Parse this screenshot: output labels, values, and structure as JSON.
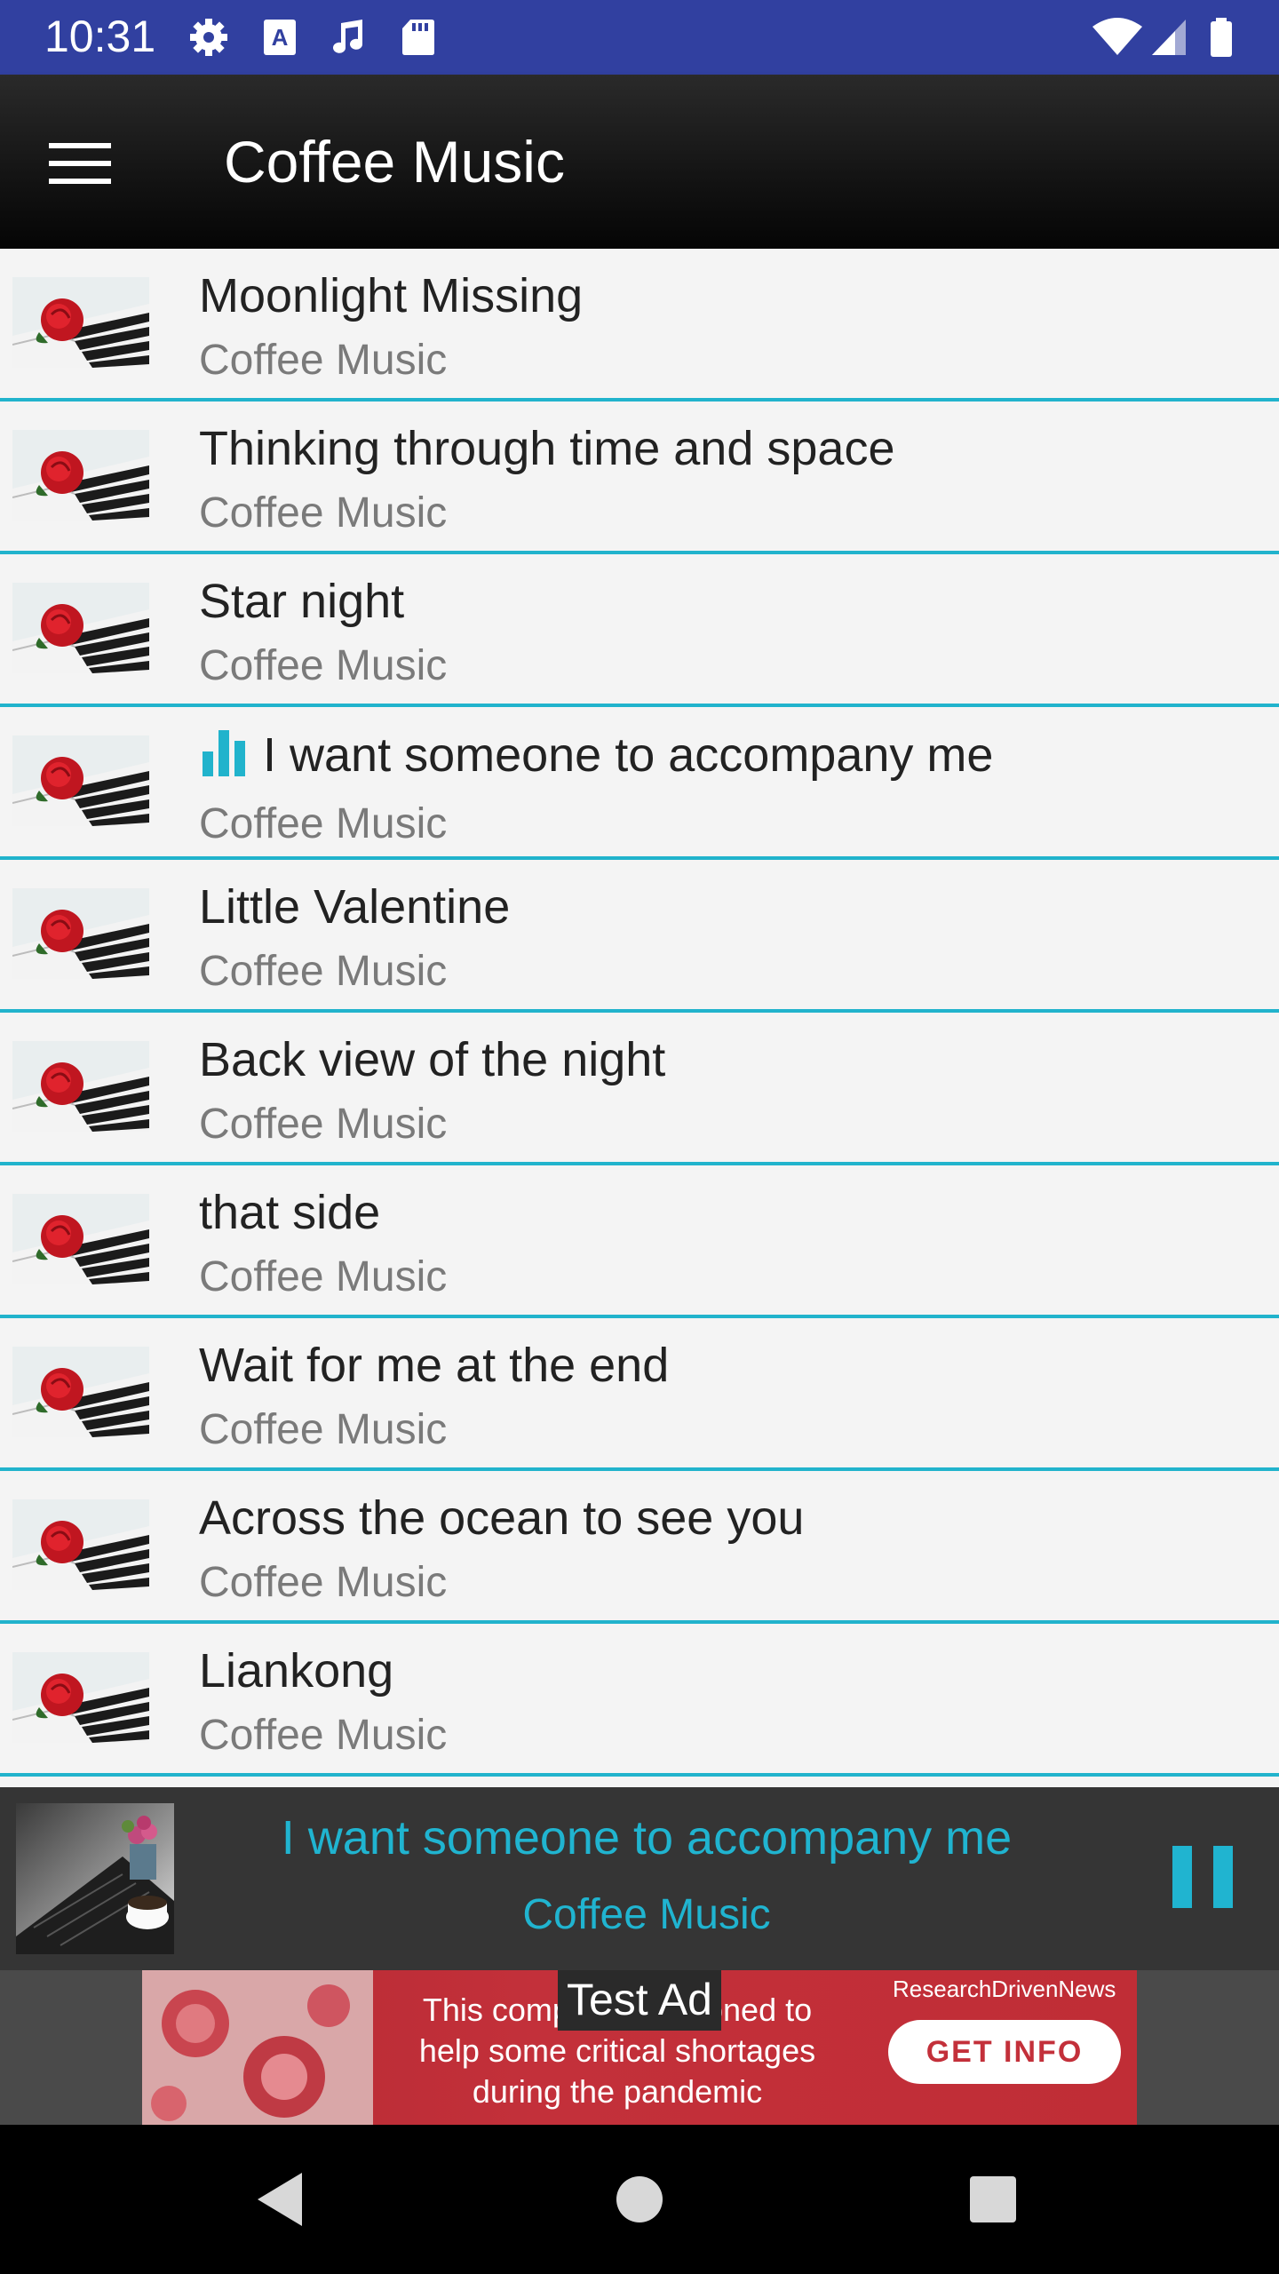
{
  "status_bar": {
    "time": "10:31",
    "left_icons": [
      "gear-icon",
      "text-a-icon",
      "music-note-icon",
      "sd-card-icon"
    ],
    "right_icons": [
      "wifi-icon",
      "cell-signal-icon",
      "battery-icon"
    ],
    "background": "#3140a0"
  },
  "toolbar": {
    "title": "Coffee Music",
    "menu_icon": "hamburger-menu-icon"
  },
  "songs": [
    {
      "title": "Moonlight Missing",
      "artist": "Coffee Music",
      "playing": false
    },
    {
      "title": "Thinking through time and space",
      "artist": "Coffee Music",
      "playing": false
    },
    {
      "title": "Star night",
      "artist": "Coffee Music",
      "playing": false
    },
    {
      "title": "I want someone to accompany me",
      "artist": "Coffee Music",
      "playing": true
    },
    {
      "title": "Little Valentine",
      "artist": "Coffee Music",
      "playing": false
    },
    {
      "title": "Back view of the night",
      "artist": "Coffee Music",
      "playing": false
    },
    {
      "title": "that side",
      "artist": "Coffee Music",
      "playing": false
    },
    {
      "title": "Wait for me at the end",
      "artist": "Coffee Music",
      "playing": false
    },
    {
      "title": "Across the ocean to see you",
      "artist": "Coffee Music",
      "playing": false
    },
    {
      "title": "Liankong",
      "artist": "Coffee Music",
      "playing": false
    }
  ],
  "now_playing": {
    "title": "I want someone to accompany me",
    "artist": "Coffee Music",
    "control_icon": "pause-icon",
    "accent_color": "#20b4d0"
  },
  "ad": {
    "label": "Test Ad",
    "text_line1": "This company positioned to",
    "text_line2": "help some critical shortages",
    "text_line3": "during the pandemic",
    "brand": "ResearchDrivenNews",
    "cta": "GET INFO"
  },
  "nav_bar": {
    "icons": [
      "back-triangle-icon",
      "home-circle-icon",
      "recents-square-icon"
    ]
  },
  "colors": {
    "accent": "#21b3cc",
    "list_background": "#f4f4f4",
    "player_background": "#353535"
  }
}
